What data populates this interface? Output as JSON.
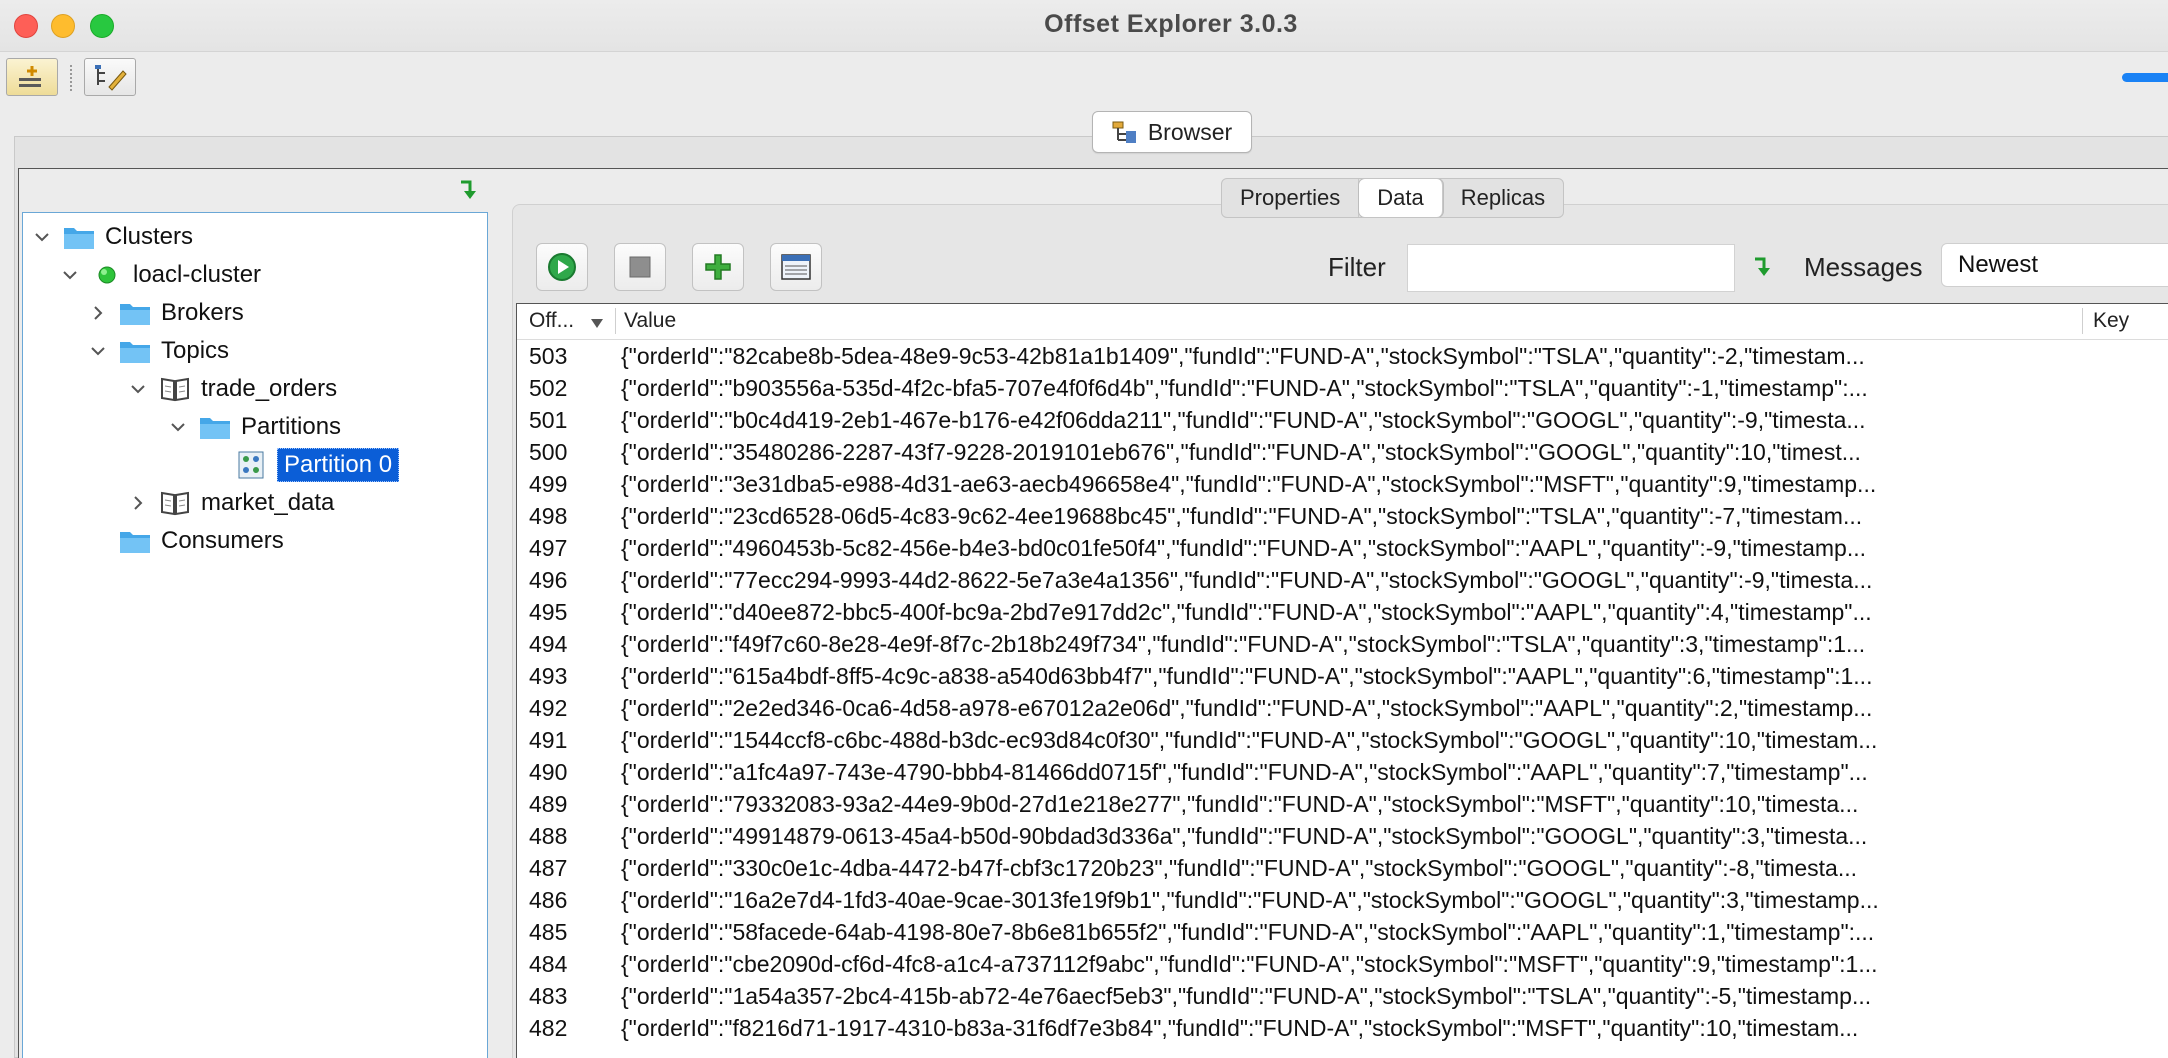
{
  "window": {
    "title": "Offset Explorer  3.0.3"
  },
  "browser_button": {
    "label": "Browser"
  },
  "tree": {
    "clusters": "Clusters",
    "cluster": "loacl-cluster",
    "brokers": "Brokers",
    "topics": "Topics",
    "topic1": "trade_orders",
    "partitions": "Partitions",
    "partition0": "Partition 0",
    "topic2": "market_data",
    "consumers": "Consumers"
  },
  "tabs": [
    "Properties",
    "Data",
    "Replicas"
  ],
  "active_tab": "Data",
  "filter": {
    "label": "Filter",
    "value": ""
  },
  "messages": {
    "label": "Messages",
    "selected": "Newest"
  },
  "table": {
    "headers": {
      "offset": "Off...",
      "value": "Value",
      "key": "Key"
    },
    "rows": [
      {
        "offset": "503",
        "value": "{\"orderId\":\"82cabe8b-5dea-48e9-9c53-42b81a1b1409\",\"fundId\":\"FUND-A\",\"stockSymbol\":\"TSLA\",\"quantity\":-2,\"timestam..."
      },
      {
        "offset": "502",
        "value": "{\"orderId\":\"b903556a-535d-4f2c-bfa5-707e4f0f6d4b\",\"fundId\":\"FUND-A\",\"stockSymbol\":\"TSLA\",\"quantity\":-1,\"timestamp\":..."
      },
      {
        "offset": "501",
        "value": "{\"orderId\":\"b0c4d419-2eb1-467e-b176-e42f06dda211\",\"fundId\":\"FUND-A\",\"stockSymbol\":\"GOOGL\",\"quantity\":-9,\"timesta..."
      },
      {
        "offset": "500",
        "value": "{\"orderId\":\"35480286-2287-43f7-9228-2019101eb676\",\"fundId\":\"FUND-A\",\"stockSymbol\":\"GOOGL\",\"quantity\":10,\"timest..."
      },
      {
        "offset": "499",
        "value": "{\"orderId\":\"3e31dba5-e988-4d31-ae63-aecb496658e4\",\"fundId\":\"FUND-A\",\"stockSymbol\":\"MSFT\",\"quantity\":9,\"timestamp..."
      },
      {
        "offset": "498",
        "value": "{\"orderId\":\"23cd6528-06d5-4c83-9c62-4ee19688bc45\",\"fundId\":\"FUND-A\",\"stockSymbol\":\"TSLA\",\"quantity\":-7,\"timestam..."
      },
      {
        "offset": "497",
        "value": "{\"orderId\":\"4960453b-5c82-456e-b4e3-bd0c01fe50f4\",\"fundId\":\"FUND-A\",\"stockSymbol\":\"AAPL\",\"quantity\":-9,\"timestamp..."
      },
      {
        "offset": "496",
        "value": "{\"orderId\":\"77ecc294-9993-44d2-8622-5e7a3e4a1356\",\"fundId\":\"FUND-A\",\"stockSymbol\":\"GOOGL\",\"quantity\":-9,\"timesta..."
      },
      {
        "offset": "495",
        "value": "{\"orderId\":\"d40ee872-bbc5-400f-bc9a-2bd7e917dd2c\",\"fundId\":\"FUND-A\",\"stockSymbol\":\"AAPL\",\"quantity\":4,\"timestamp\"..."
      },
      {
        "offset": "494",
        "value": "{\"orderId\":\"f49f7c60-8e28-4e9f-8f7c-2b18b249f734\",\"fundId\":\"FUND-A\",\"stockSymbol\":\"TSLA\",\"quantity\":3,\"timestamp\":1..."
      },
      {
        "offset": "493",
        "value": "{\"orderId\":\"615a4bdf-8ff5-4c9c-a838-a540d63bb4f7\",\"fundId\":\"FUND-A\",\"stockSymbol\":\"AAPL\",\"quantity\":6,\"timestamp\":1..."
      },
      {
        "offset": "492",
        "value": "{\"orderId\":\"2e2ed346-0ca6-4d58-a978-e67012a2e06d\",\"fundId\":\"FUND-A\",\"stockSymbol\":\"AAPL\",\"quantity\":2,\"timestamp..."
      },
      {
        "offset": "491",
        "value": "{\"orderId\":\"1544ccf8-c6bc-488d-b3dc-ec93d84c0f30\",\"fundId\":\"FUND-A\",\"stockSymbol\":\"GOOGL\",\"quantity\":10,\"timestam..."
      },
      {
        "offset": "490",
        "value": "{\"orderId\":\"a1fc4a97-743e-4790-bbb4-81466dd0715f\",\"fundId\":\"FUND-A\",\"stockSymbol\":\"AAPL\",\"quantity\":7,\"timestamp\"..."
      },
      {
        "offset": "489",
        "value": "{\"orderId\":\"79332083-93a2-44e9-9b0d-27d1e218e277\",\"fundId\":\"FUND-A\",\"stockSymbol\":\"MSFT\",\"quantity\":10,\"timesta..."
      },
      {
        "offset": "488",
        "value": "{\"orderId\":\"49914879-0613-45a4-b50d-90bdad3d336a\",\"fundId\":\"FUND-A\",\"stockSymbol\":\"GOOGL\",\"quantity\":3,\"timesta..."
      },
      {
        "offset": "487",
        "value": "{\"orderId\":\"330c0e1c-4dba-4472-b47f-cbf3c1720b23\",\"fundId\":\"FUND-A\",\"stockSymbol\":\"GOOGL\",\"quantity\":-8,\"timesta..."
      },
      {
        "offset": "486",
        "value": "{\"orderId\":\"16a2e7d4-1fd3-40ae-9cae-3013fe19f9b1\",\"fundId\":\"FUND-A\",\"stockSymbol\":\"GOOGL\",\"quantity\":3,\"timestamp..."
      },
      {
        "offset": "485",
        "value": "{\"orderId\":\"58facede-64ab-4198-80e7-8b6e81b655f2\",\"fundId\":\"FUND-A\",\"stockSymbol\":\"AAPL\",\"quantity\":1,\"timestamp\":..."
      },
      {
        "offset": "484",
        "value": "{\"orderId\":\"cbe2090d-cf6d-4fc8-a1c4-a737112f9abc\",\"fundId\":\"FUND-A\",\"stockSymbol\":\"MSFT\",\"quantity\":9,\"timestamp\":1..."
      },
      {
        "offset": "483",
        "value": "{\"orderId\":\"1a54a357-2bc4-415b-ab72-4e76aecf5eb3\",\"fundId\":\"FUND-A\",\"stockSymbol\":\"TSLA\",\"quantity\":-5,\"timestamp..."
      },
      {
        "offset": "482",
        "value": "{\"orderId\":\"f8216d71-1917-4310-b83a-31f6df7e3b84\",\"fundId\":\"FUND-A\",\"stockSymbol\":\"MSFT\",\"quantity\":10,\"timestam..."
      }
    ]
  },
  "colors": {
    "selection": "#0b5ed7",
    "connected": "#2ec43a",
    "accent": "#1a82f5"
  }
}
